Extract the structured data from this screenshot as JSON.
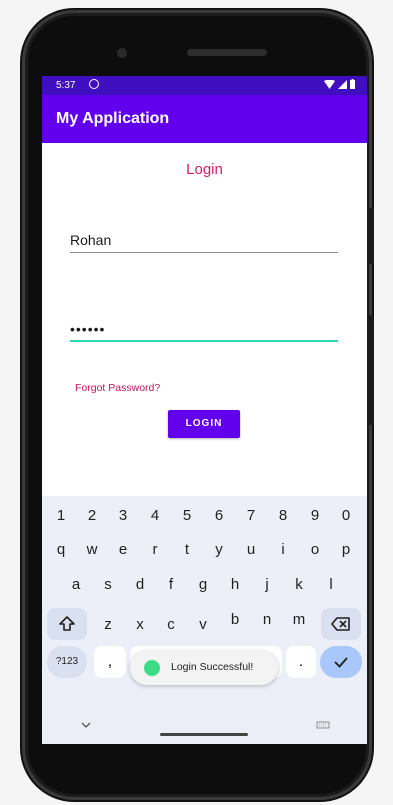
{
  "status": {
    "time": "5:37"
  },
  "appbar": {
    "title": "My Application"
  },
  "form": {
    "title": "Login",
    "username": "Rohan",
    "password_masked": "••••••",
    "forgot_label": "Forgot Password?",
    "login_label": "LOGIN"
  },
  "keyboard": {
    "numbers": [
      "1",
      "2",
      "3",
      "4",
      "5",
      "6",
      "7",
      "8",
      "9",
      "0"
    ],
    "row1": [
      "q",
      "w",
      "e",
      "r",
      "t",
      "y",
      "u",
      "i",
      "o",
      "p"
    ],
    "row2": [
      "a",
      "s",
      "d",
      "f",
      "g",
      "h",
      "j",
      "k",
      "l"
    ],
    "row3": [
      "z",
      "x",
      "c",
      "v",
      "b",
      "n",
      "m"
    ],
    "mode_label": "?123",
    "comma": ",",
    "period": "."
  },
  "toast": {
    "message": "Login Successful!"
  },
  "colors": {
    "appbar": "#6200ee",
    "statusbar": "#3f0fbf",
    "accent": "#d81b60",
    "focus_line": "#2dd8b8"
  }
}
